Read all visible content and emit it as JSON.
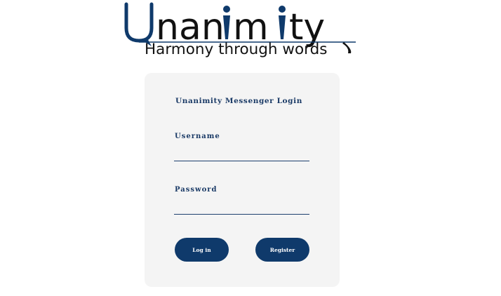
{
  "logo": {
    "wordmark": "Unanimity",
    "tagline": "Harmony through words"
  },
  "login_card": {
    "title": "Unanimity Messenger Login",
    "username_label": "Username",
    "username_value": "",
    "password_label": "Password",
    "password_value": "",
    "login_button": "Log in",
    "register_button": "Register"
  },
  "colors": {
    "brand_navy": "#0f3a6b",
    "card_background": "#f4f4f4",
    "label_text": "#1a3a66"
  }
}
